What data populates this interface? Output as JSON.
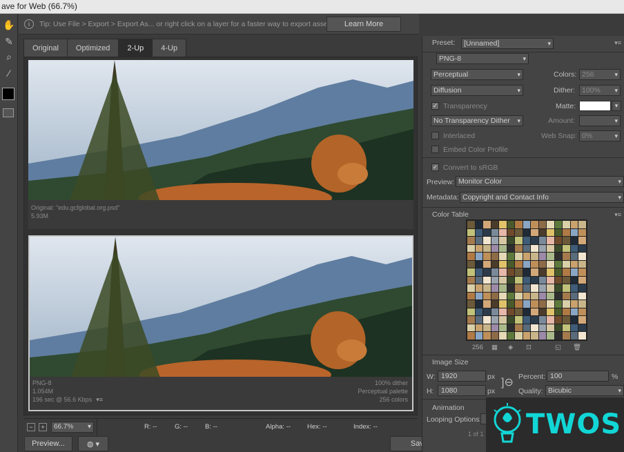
{
  "window": {
    "title": "ave for Web (66.7%)"
  },
  "tip": {
    "text": "Tip: Use File > Export > Export As...  or right click on a layer for a faster way to export assets",
    "learn_more": "Learn More"
  },
  "view_tabs": [
    {
      "label": "Original",
      "active": false
    },
    {
      "label": "Optimized",
      "active": false
    },
    {
      "label": "2-Up",
      "active": true
    },
    {
      "label": "4-Up",
      "active": false
    }
  ],
  "original_pane": {
    "line1": "Original: \"edu.gcfglobal.org.psd\"",
    "line2": "5.93M"
  },
  "optimized_pane": {
    "format": "PNG-8",
    "size": "1.054M",
    "time": "196 sec @ 56.6 Kbps",
    "dither": "100% dither",
    "palette": "Perceptual palette",
    "colors": "256 colors"
  },
  "status": {
    "minus": "−",
    "plus": "+",
    "zoom": "66.7%",
    "r": "R: --",
    "g": "G: --",
    "b": "B: --",
    "alpha": "Alpha: --",
    "hex": "Hex: --",
    "index": "Index: --"
  },
  "buttons": {
    "preview": "Preview...",
    "save": "Save..."
  },
  "settings": {
    "preset_label": "Preset:",
    "preset_value": "[Unnamed]",
    "format": "PNG-8",
    "reduction": "Perceptual",
    "colors_label": "Colors:",
    "colors_value": "256",
    "dither_algo": "Diffusion",
    "dither_label": "Dither:",
    "dither_value": "100%",
    "transparency": "Transparency",
    "matte_label": "Matte:",
    "trans_dither": "No Transparency Dither",
    "amount_label": "Amount:",
    "interlaced": "Interlaced",
    "websnap_label": "Web Snap:",
    "websnap_value": "0%",
    "embed_profile": "Embed Color Profile",
    "convert_srgb": "Convert to sRGB",
    "preview_label": "Preview:",
    "preview_value": "Monitor Color",
    "metadata_label": "Metadata:",
    "metadata_value": "Copyright and Contact Info"
  },
  "color_table": {
    "title": "Color Table",
    "count": "256",
    "colors": [
      "#6b5a3a",
      "#c9a26e",
      "#2c3b4a",
      "#8e6b47",
      "#d8c9a4",
      "#4a5a2b",
      "#a57b4d",
      "#1f2a36",
      "#c8b58a",
      "#7a8a9a",
      "#e6d9b5",
      "#3a4a2a",
      "#b07a45",
      "#5a6b7c",
      "#d2a879"
    ]
  },
  "image_size": {
    "title": "Image Size",
    "w_label": "W:",
    "w_value": "1920",
    "h_label": "H:",
    "h_value": "1080",
    "unit": "px",
    "percent_label": "Percent:",
    "percent_value": "100",
    "percent_unit": "%",
    "quality_label": "Quality:",
    "quality_value": "Bicubic"
  },
  "animation": {
    "title": "Animation",
    "looping_label": "Looping Options:",
    "frame": "1 of 1"
  },
  "logo": {
    "text": "TWOS"
  }
}
